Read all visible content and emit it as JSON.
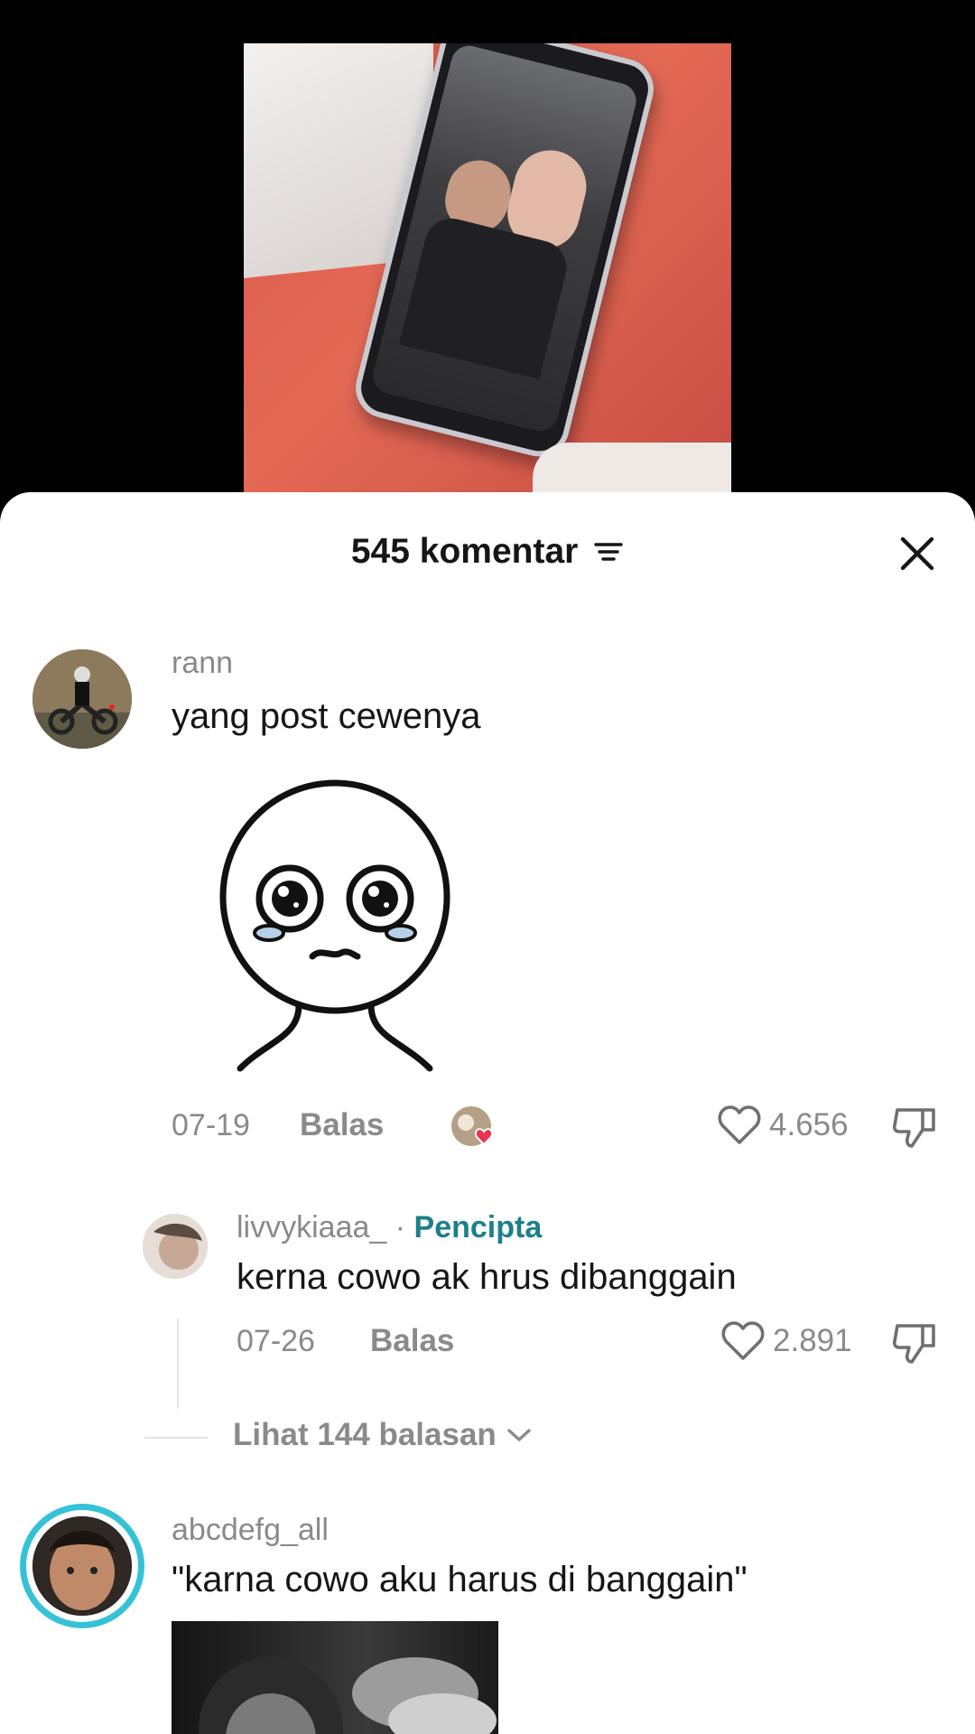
{
  "header": {
    "title": "545 komentar"
  },
  "comments": [
    {
      "username": "rann",
      "text": "yang post cewenya",
      "date": "07-19",
      "reply_label": "Balas",
      "likes": "4.656",
      "sticker": "crying-face-sticker"
    },
    {
      "username": "livvykiaaa_",
      "separator": " · ",
      "badge": "Pencipta",
      "text": "kerna cowo ak hrus dibanggain",
      "date": "07-26",
      "reply_label": "Balas",
      "likes": "2.891"
    },
    {
      "username": "abcdefg_all",
      "text": "\"karna cowo aku harus di banggain\""
    }
  ],
  "view_replies": {
    "label": "Lihat 144 balasan"
  },
  "colors": {
    "creator": "#1d7f8c",
    "liked_heart": "#e8344f",
    "avatar_ring": "#35c2d6"
  }
}
